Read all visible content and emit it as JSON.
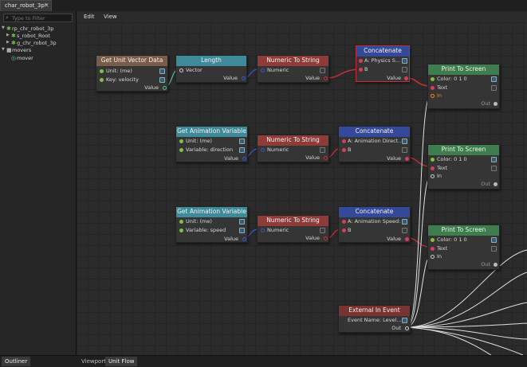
{
  "window": {
    "tab_title": "char_robot_3p*",
    "tab_close": "×"
  },
  "outliner": {
    "filter_placeholder": "Type to Filter",
    "tree": [
      {
        "label": "rp_chr_robot_3p",
        "twisty": "▼"
      },
      {
        "label": "s_robot_Root",
        "twisty": "▶"
      },
      {
        "label": "g_chr_robot_3p",
        "twisty": "▶"
      },
      {
        "label": "movers",
        "twisty": "▼"
      },
      {
        "label": "mover",
        "twisty": ""
      }
    ]
  },
  "menu": {
    "edit": "Edit",
    "view": "View"
  },
  "bottom_tabs": {
    "outliner": "Outliner",
    "viewport": "Viewport",
    "unit_flow": "Unit Flow"
  },
  "nodes": {
    "get_unit_vector": {
      "title": "Get Unit Vector Data",
      "unit": "Unit: (me)",
      "key": "Key: velocity",
      "value": "Value"
    },
    "length": {
      "title": "Length",
      "vector": "Vector",
      "value": "Value"
    },
    "nts1": {
      "title": "Numeric To String",
      "numeric": "Numeric",
      "value": "Value"
    },
    "concat1": {
      "title": "Concatenate",
      "a": "A: Physics S...",
      "b": "B",
      "value": "Value"
    },
    "pts1": {
      "title": "Print To Screen",
      "color": "Color: 0 1 0",
      "text": "Text",
      "in": "In",
      "out": "Out"
    },
    "gav1": {
      "title": "Get Animation Variable",
      "unit": "Unit: (me)",
      "variable": "Variable: direction",
      "value": "Value"
    },
    "nts2": {
      "title": "Numeric To String",
      "numeric": "Numeric",
      "value": "Value"
    },
    "concat2": {
      "title": "Concatenate",
      "a": "A: Animation Direct...",
      "b": "B",
      "value": "Value"
    },
    "pts2": {
      "title": "Print To Screen",
      "color": "Color: 0 1 0",
      "text": "Text",
      "in": "In",
      "out": "Out"
    },
    "gav2": {
      "title": "Get Animation Variable",
      "unit": "Unit: (me)",
      "variable": "Variable: speed",
      "value": "Value"
    },
    "nts3": {
      "title": "Numeric To String",
      "numeric": "Numeric",
      "value": "Value"
    },
    "concat3": {
      "title": "Concatenate",
      "a": "A: Animation Speed:",
      "b": "B",
      "value": "Value"
    },
    "pts3": {
      "title": "Print To Screen",
      "color": "Color: 0 1 0",
      "text": "Text",
      "in": "In",
      "out": "Out"
    },
    "ext": {
      "title": "External In Event",
      "event_name": "Event Name: Level...",
      "out": "Out"
    }
  },
  "colors": {
    "node_brown": "#7a5c4a",
    "node_teal": "#3e8a9a",
    "node_red": "#8f3b3a",
    "node_blue": "#35499b",
    "node_green": "#3e7d4d",
    "wire_red": "#c0303a",
    "wire_blue": "#3b55c4",
    "wire_green": "#55c08a",
    "wire_white": "#e0e0e0",
    "pin_green": "#7fc241",
    "pin_pink": "#d4405c"
  },
  "icons": {
    "edit": "pencil-edit-icon",
    "search": "search-icon",
    "folder": "folder-icon",
    "unit": "unit-gear-icon",
    "mover": "mover-icon"
  }
}
